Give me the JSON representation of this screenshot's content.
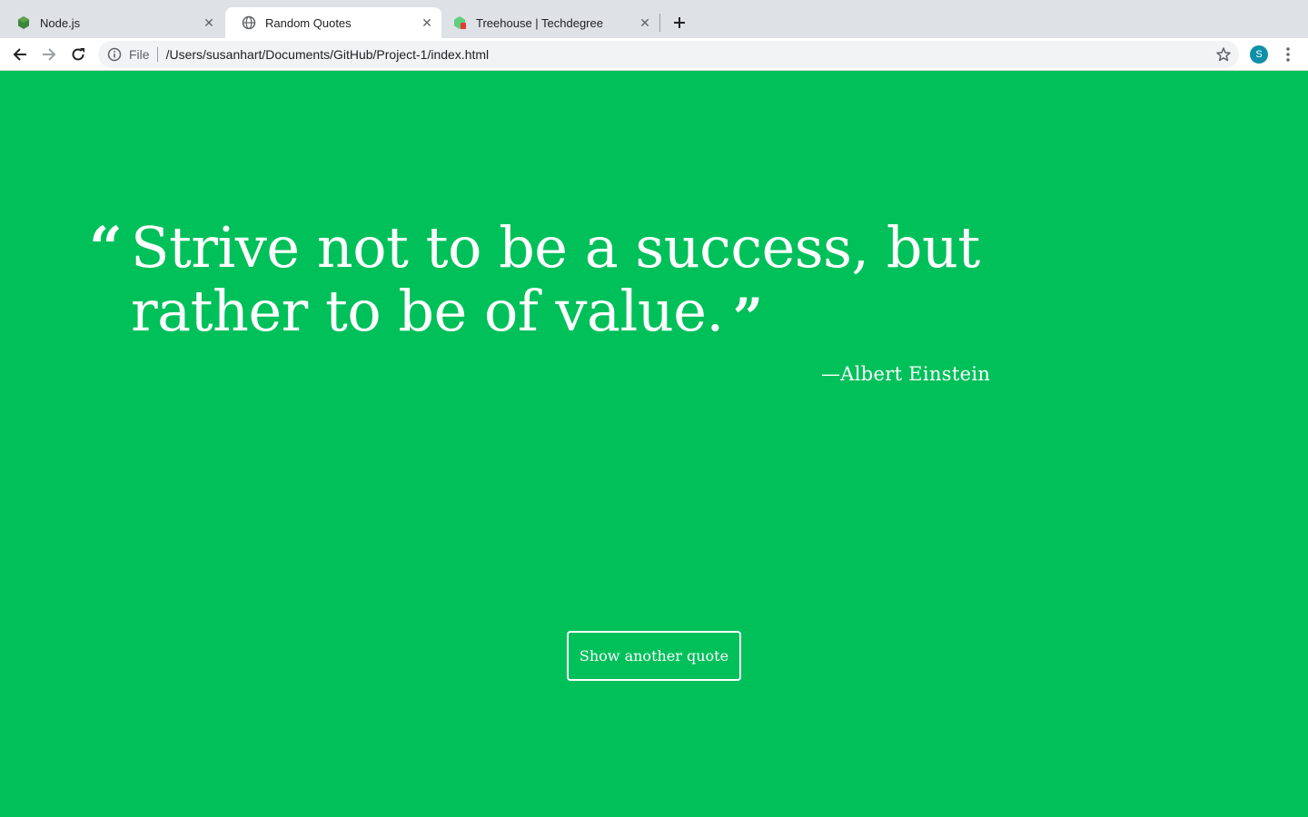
{
  "browser": {
    "tabs": [
      {
        "title": "Node.js",
        "favicon": "nodejs-icon",
        "active": false
      },
      {
        "title": "Random Quotes",
        "favicon": "globe-icon",
        "active": true
      },
      {
        "title": "Treehouse | Techdegree",
        "favicon": "treehouse-icon",
        "active": false
      }
    ],
    "omnibox": {
      "scheme_label": "File",
      "url": "/Users/susanhart/Documents/GitHub/Project-1/index.html"
    },
    "profile_initial": "S",
    "colors": {
      "tabstrip": "#dee1e6",
      "toolbar": "#ffffff",
      "omnibox": "#f1f3f4",
      "avatar": "#0f8fa8"
    }
  },
  "page": {
    "background": "#00c05a",
    "quote": {
      "text": "Strive not to be a success, but rather to be of value.",
      "open_mark": "“",
      "close_mark": "”",
      "source": "—Albert Einstein"
    },
    "button_label": "Show another quote"
  }
}
